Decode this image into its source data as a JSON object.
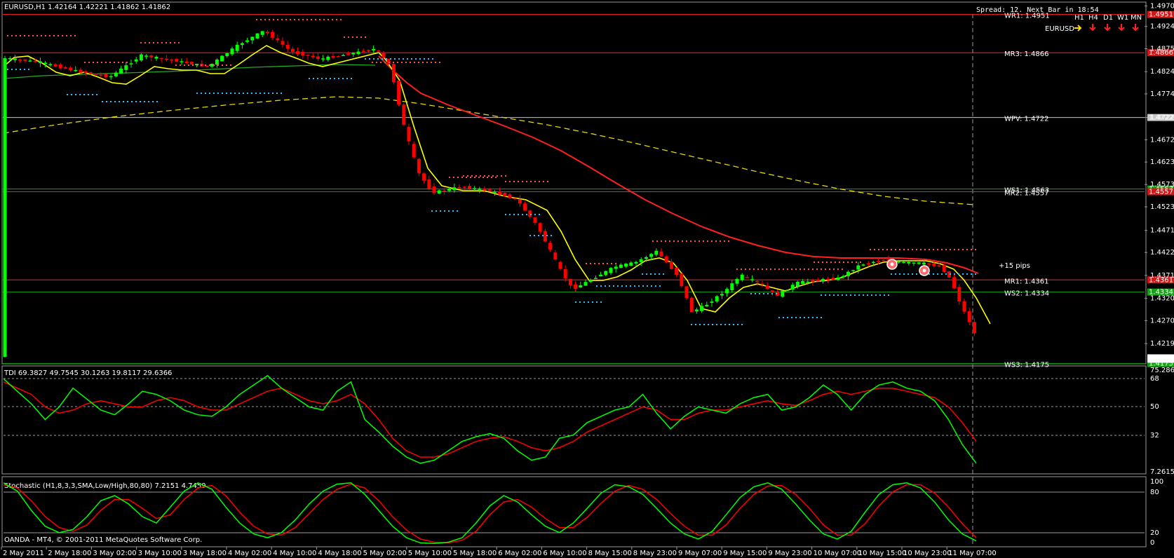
{
  "main": {
    "header": "EURUSD,H1  1.42164 1.42221 1.41862 1.41862",
    "spread_text": "Spread: 12. Next Bar in 18:54",
    "copyright": "OANDA - MT4, © 2001-2011 MetaQuotes Software Corp.",
    "pips_note": "+15 pips",
    "price_ticks": [
      "1.4970",
      "1.49245",
      "1.4875",
      "1.48240",
      "1.47745",
      "1.47220",
      "1.46725",
      "1.46230",
      "1.45730",
      "1.45235",
      "1.44710",
      "1.44220",
      "1.43710",
      "1.43200",
      "1.42705",
      "1.42195",
      "1.41862"
    ],
    "pivot_levels": [
      {
        "label": "WR1:  1.4951",
        "price": 1.4951,
        "line": "#ff2020",
        "tag": "1.4951",
        "tag_bg": "#d01818"
      },
      {
        "label": "MR3:  1.4866",
        "price": 1.4866,
        "line": "#ff2020",
        "tag": "1.4866",
        "tag_bg": "#d01818"
      },
      {
        "label": "WPV:  1.4722",
        "price": 1.4722,
        "line": "#c8c8c8",
        "tag": "1.4722",
        "tag_bg": "#c8c8c8"
      },
      {
        "label": "WS1:  1.4563",
        "price": 1.4563,
        "line": "#18a018",
        "tag": "1.4563",
        "tag_bg": "#18a018"
      },
      {
        "label": "MR2:  1.4557",
        "price": 1.4557,
        "line": "#ff2020",
        "tag": "1.4557",
        "tag_bg": "#d01818"
      },
      {
        "label": "MR1:  1.4361",
        "price": 1.4361,
        "line": "#ff2020",
        "tag": "1.4361",
        "tag_bg": "#d01818"
      },
      {
        "label": "WS2:  1.4334",
        "price": 1.4334,
        "line": "#18a018",
        "tag": "1.4334",
        "tag_bg": "#18a018"
      },
      {
        "label": "WS3:  1.4175",
        "price": 1.4175,
        "line": "#18a018",
        "tag": "1.4175",
        "tag_bg": "#18a018"
      }
    ],
    "timeframe_panel": {
      "symbol": "EURUSD",
      "timeframes": [
        "H1",
        "H4",
        "D1",
        "W1",
        "MN"
      ],
      "directions": [
        "right",
        "down",
        "down",
        "down",
        "down"
      ]
    }
  },
  "tdi": {
    "header": "TDI 69.3827 49.7545 30.1263 19.8117 29.6366",
    "ticks": [
      "75.2867",
      "68",
      "50",
      "32",
      "7.2615"
    ]
  },
  "stochastic": {
    "header": "Stochastic (H1,8,3,3,SMA,Low/High,80,80) 7.2151 4.7459",
    "ticks": [
      "100",
      "80",
      "20",
      "0"
    ]
  },
  "time_labels": [
    "2 May 2011",
    "2 May 18:00",
    "3 May 02:00",
    "3 May 10:00",
    "3 May 18:00",
    "4 May 02:00",
    "4 May 10:00",
    "4 May 18:00",
    "5 May 02:00",
    "5 May 10:00",
    "5 May 18:00",
    "6 May 02:00",
    "6 May 10:00",
    "8 May 15:00",
    "8 May 23:00",
    "9 May 07:00",
    "9 May 15:00",
    "9 May 23:00",
    "10 May 07:00",
    "10 May 15:00",
    "10 May 23:00",
    "11 May 07:00"
  ],
  "colors": {
    "bull": "#00ff00",
    "bear": "#ff0000",
    "ma_fast": "#ffff00",
    "ma_slow": "#ff2020",
    "ma_long": "#e6d800",
    "ma_mid": "#22aa22",
    "grid": "#9a9a9a",
    "tdi_green": "#00ff00",
    "tdi_red": "#ff0000"
  },
  "chart_data": [
    {
      "type": "candlestick",
      "title": "EURUSD,H1",
      "y_ticks": [
        1.497,
        1.49245,
        1.4875,
        1.4824,
        1.47745,
        1.4722,
        1.46725,
        1.4623,
        1.4573,
        1.45235,
        1.4471,
        1.4422,
        1.4371,
        1.432,
        1.42705,
        1.42195
      ],
      "ylim": [
        1.4176,
        1.4977
      ],
      "x_range": [
        "2 May 2011",
        "11 May 07:00"
      ],
      "key_points": [
        {
          "x": "2 May 2011",
          "price": 1.4855
        },
        {
          "x": "4 May 02:00",
          "price": 1.4915
        },
        {
          "x": "5 May 02:00",
          "price": 1.488
        },
        {
          "x": "5 May 10:00",
          "price": 1.455
        },
        {
          "x": "6 May 02:00",
          "price": 1.4555
        },
        {
          "x": "8 May 15:00",
          "price": 1.4335
        },
        {
          "x": "8 May 23:00",
          "price": 1.4425
        },
        {
          "x": "9 May 07:00",
          "price": 1.428
        },
        {
          "x": "10 May 15:00",
          "price": 1.441
        },
        {
          "x": "11 May 07:00",
          "price": 1.4186
        }
      ]
    },
    {
      "type": "line",
      "title": "TDI",
      "y_ticks": [
        68,
        50,
        32
      ],
      "ylim": [
        7.2615,
        75.2867
      ],
      "series": [
        {
          "color": "green",
          "values": [
            68,
            60,
            52,
            42,
            50,
            62,
            55,
            48,
            45,
            52,
            60,
            58,
            54,
            48,
            45,
            44,
            50,
            58,
            64,
            70,
            62,
            56,
            50,
            48,
            60,
            66,
            42,
            34,
            25,
            18,
            14,
            16,
            22,
            28,
            31,
            33,
            30,
            22,
            16,
            18,
            30,
            32,
            40,
            44,
            48,
            50,
            58,
            46,
            36,
            44,
            50,
            48,
            46,
            52,
            56,
            58,
            48,
            50,
            56,
            64,
            58,
            48,
            58,
            64,
            66,
            62,
            60,
            54,
            42,
            26,
            14
          ]
        },
        {
          "color": "red",
          "values": [
            66,
            62,
            58,
            50,
            46,
            48,
            52,
            54,
            52,
            50,
            50,
            54,
            56,
            54,
            50,
            48,
            48,
            52,
            56,
            60,
            62,
            58,
            54,
            52,
            54,
            58,
            52,
            42,
            30,
            22,
            18,
            18,
            20,
            24,
            28,
            30,
            31,
            28,
            24,
            22,
            24,
            28,
            34,
            38,
            42,
            46,
            50,
            48,
            42,
            42,
            46,
            48,
            48,
            50,
            52,
            54,
            52,
            51,
            54,
            58,
            60,
            58,
            60,
            62,
            62,
            60,
            58,
            56,
            50,
            40,
            28
          ]
        }
      ]
    },
    {
      "type": "line",
      "title": "Stochastic (H1,8,3,3,SMA,Low/High,80,80)",
      "y_ticks": [
        100,
        80,
        20,
        0
      ],
      "ylim": [
        0,
        100
      ],
      "series": [
        {
          "color": "green",
          "values": [
            98,
            85,
            55,
            30,
            20,
            25,
            45,
            70,
            78,
            65,
            45,
            35,
            60,
            85,
            98,
            88,
            60,
            35,
            18,
            12,
            20,
            40,
            65,
            85,
            96,
            98,
            80,
            55,
            30,
            12,
            4,
            3,
            5,
            12,
            35,
            62,
            78,
            68,
            48,
            30,
            20,
            35,
            58,
            82,
            95,
            92,
            80,
            58,
            35,
            18,
            10,
            22,
            48,
            75,
            92,
            98,
            88,
            65,
            40,
            18,
            10,
            22,
            52,
            80,
            95,
            98,
            90,
            68,
            40,
            18,
            7
          ]
        },
        {
          "color": "red",
          "values": [
            95,
            90,
            70,
            45,
            28,
            22,
            32,
            55,
            72,
            72,
            58,
            42,
            48,
            72,
            90,
            94,
            78,
            52,
            30,
            18,
            16,
            28,
            50,
            72,
            88,
            96,
            90,
            70,
            45,
            24,
            10,
            5,
            4,
            8,
            22,
            48,
            68,
            72,
            60,
            42,
            28,
            28,
            44,
            66,
            85,
            94,
            88,
            72,
            50,
            30,
            16,
            16,
            32,
            58,
            80,
            93,
            94,
            80,
            58,
            32,
            16,
            16,
            34,
            62,
            84,
            95,
            95,
            82,
            60,
            34,
            12
          ]
        }
      ]
    }
  ]
}
